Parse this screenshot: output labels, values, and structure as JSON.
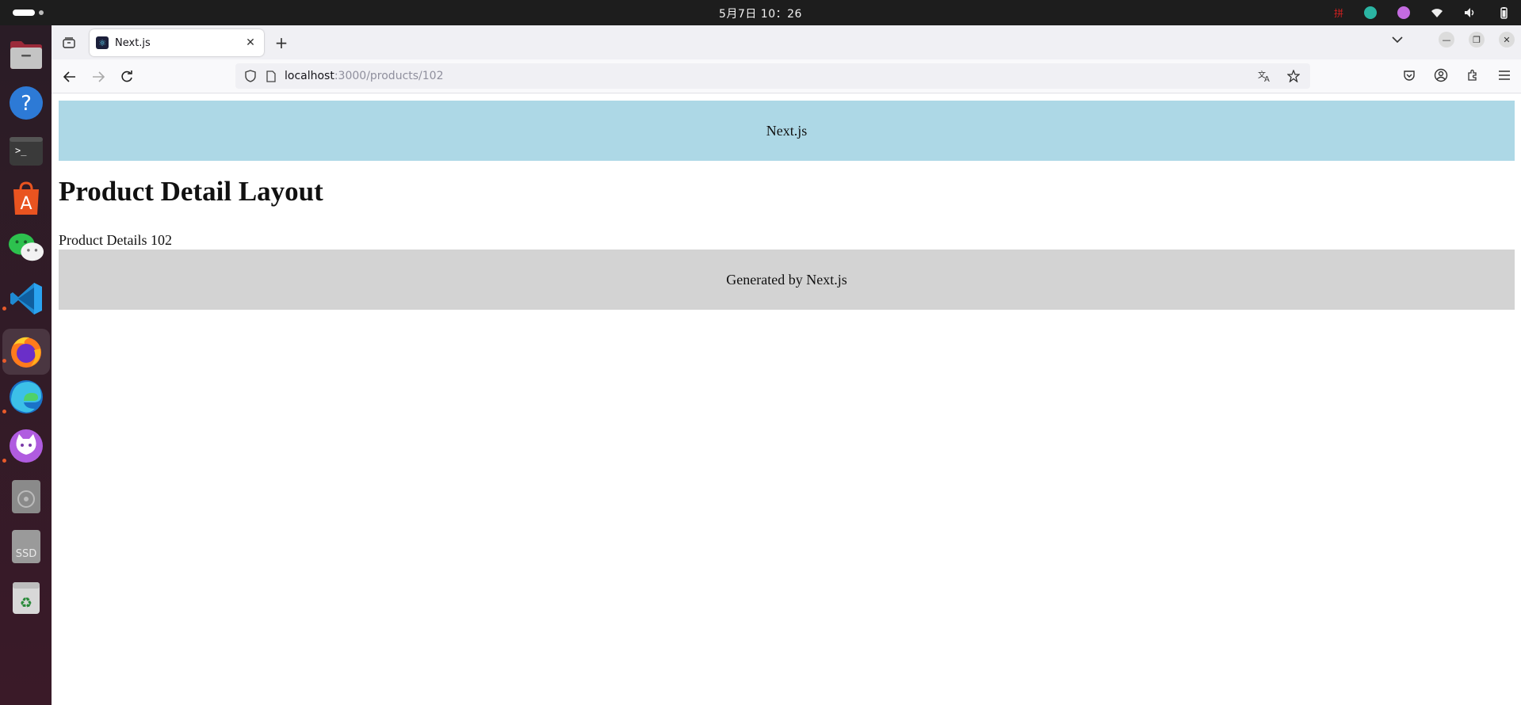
{
  "system": {
    "clock": "5月7日  10：26",
    "ime": "拼"
  },
  "browser": {
    "tab": {
      "title": "Next.js"
    },
    "new_tab": "+",
    "url": {
      "host": "localhost",
      "path": ":3000/products/102"
    }
  },
  "page": {
    "header_text": "Next.js",
    "title": "Product Detail Layout",
    "details": "Product Details 102",
    "footer_text": "Generated by Next.js"
  },
  "colors": {
    "header_bg": "#add8e6",
    "footer_bg": "#d3d3d3"
  }
}
